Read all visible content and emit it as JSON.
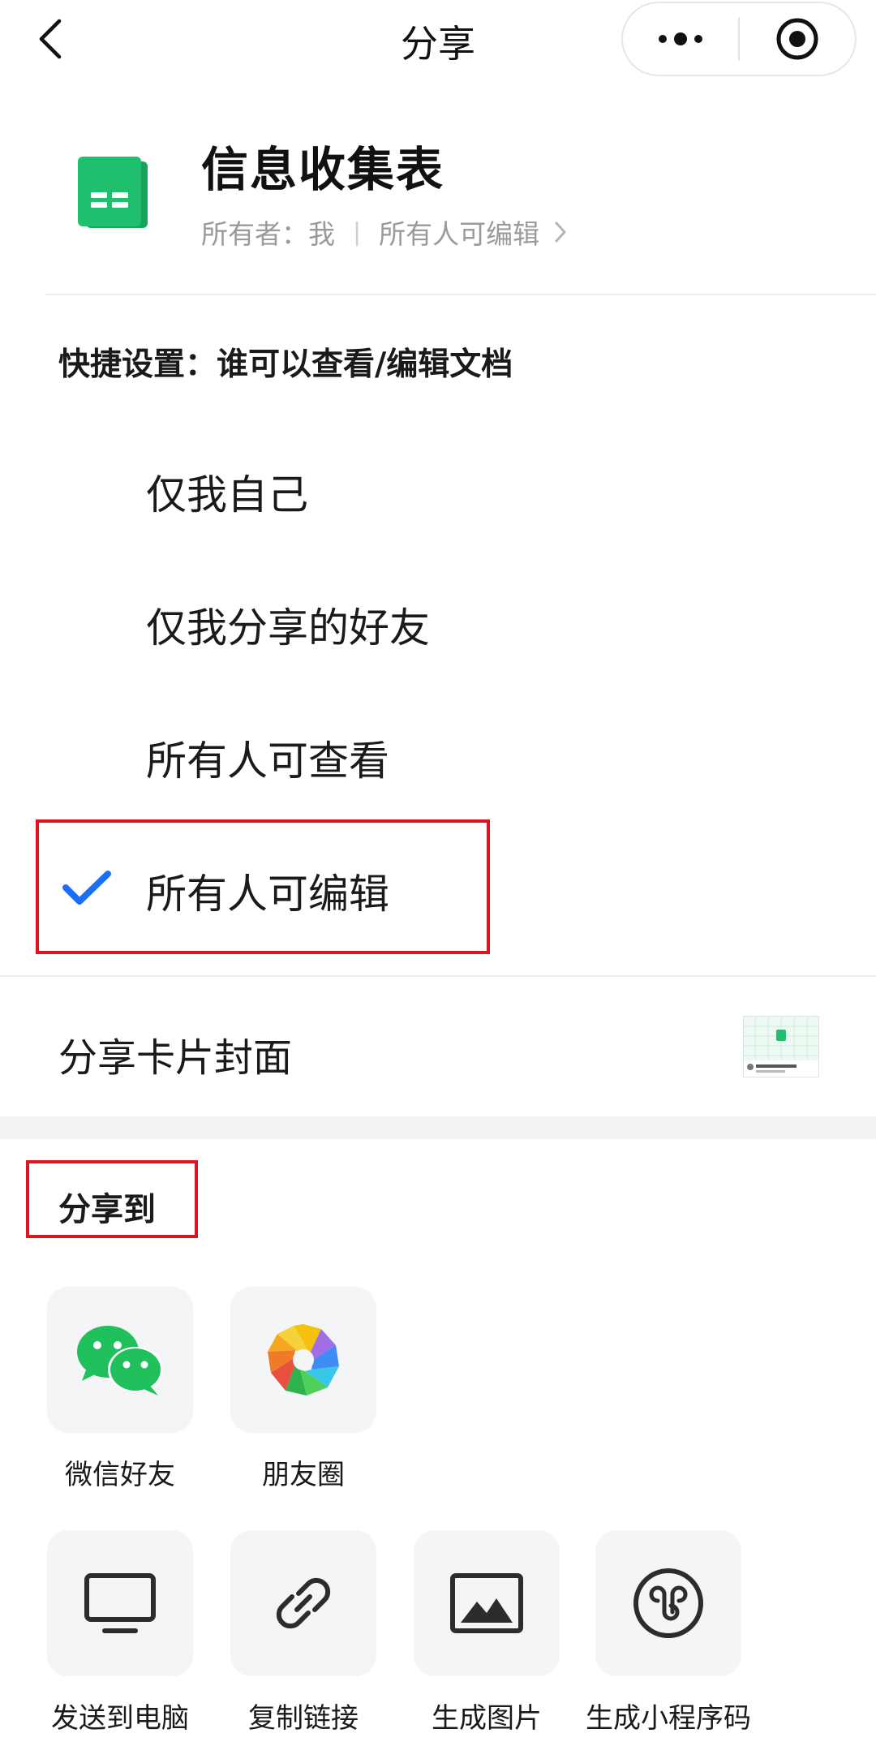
{
  "header": {
    "title": "分享",
    "back_icon": "chevron-left-icon",
    "more_icon": "more-dots-icon",
    "close_icon": "target-circle-icon"
  },
  "doc": {
    "title": "信息收集表",
    "owner": "所有者：我",
    "permission": "所有人可编辑",
    "icon": "spreadsheet-icon",
    "icon_color": "#1db56a"
  },
  "quick_settings": {
    "label": "快捷设置：谁可以查看/编辑文档",
    "options": [
      {
        "label": "仅我自己",
        "selected": false
      },
      {
        "label": "仅我分享的好友",
        "selected": false
      },
      {
        "label": "所有人可查看",
        "selected": false
      },
      {
        "label": "所有人可编辑",
        "selected": true
      }
    ],
    "check_color": "#1a6ef5"
  },
  "cover": {
    "label": "分享卡片封面"
  },
  "share_to": {
    "label": "分享到",
    "row1": [
      {
        "label": "微信好友",
        "icon": "wechat-icon"
      },
      {
        "label": "朋友圈",
        "icon": "moments-icon"
      }
    ],
    "row2": [
      {
        "label": "发送到电脑",
        "icon": "monitor-icon"
      },
      {
        "label": "复制链接",
        "icon": "link-icon"
      },
      {
        "label": "生成图片",
        "icon": "image-icon"
      },
      {
        "label": "生成小程序码",
        "icon": "miniprogram-code-icon"
      }
    ]
  },
  "colors": {
    "highlight": "#e0141e",
    "wechat_green": "#20c05c"
  }
}
